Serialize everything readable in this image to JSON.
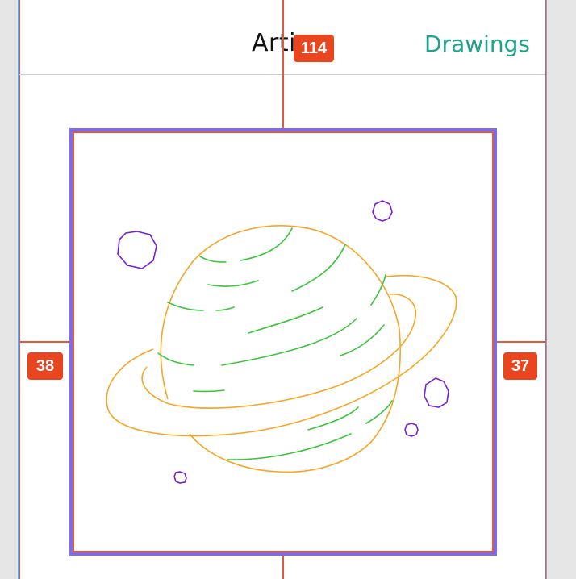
{
  "header": {
    "title": "Arti",
    "nav_link": "Drawings"
  },
  "measurements": {
    "top": "114",
    "left": "38",
    "right": "37"
  },
  "colors": {
    "accent": "#1ea38d",
    "guide": "#e25a3a",
    "badge": "#e9451f",
    "selection": "#7b6cf0",
    "planet_body": "#f5a623",
    "planet_stripes": "#3cc43c",
    "stars": "#7a1fd6"
  },
  "drawing": {
    "subject": "planet-illustration"
  }
}
